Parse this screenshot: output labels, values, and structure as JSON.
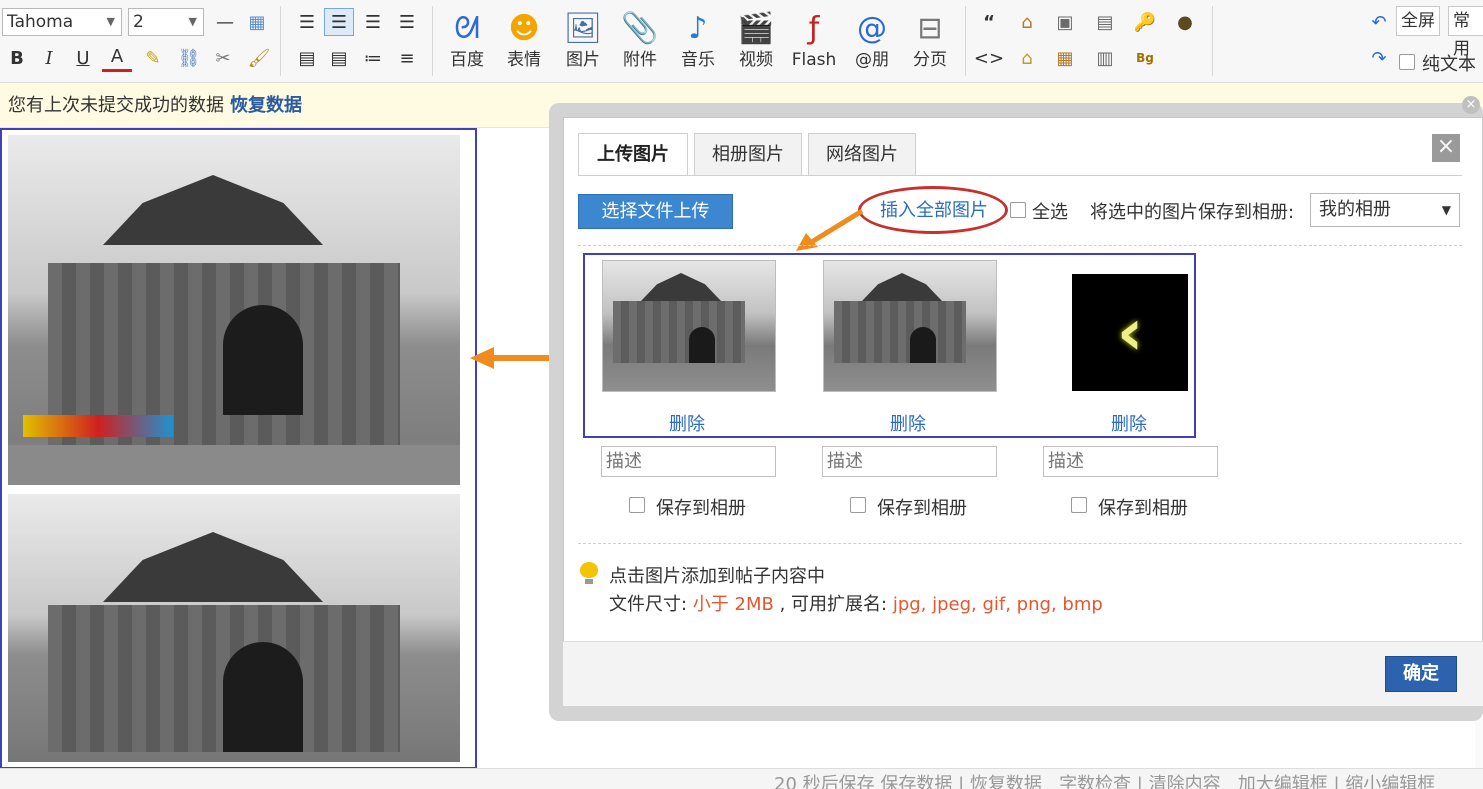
{
  "toolbar": {
    "font_family": "Tahoma",
    "font_size": "2",
    "buttons": {
      "baidu": "百度",
      "emoji": "表情",
      "image": "图片",
      "attach": "附件",
      "music": "音乐",
      "video": "视频",
      "flash": "Flash",
      "at": "@朋",
      "pagebreak": "分页"
    },
    "fullscreen": "全屏",
    "common": "常用",
    "plaintext": "纯文本"
  },
  "notice": {
    "text": "您有上次未提交成功的数据",
    "restore_link": "恢复数据"
  },
  "dialog": {
    "tabs": [
      "上传图片",
      "相册图片",
      "网络图片"
    ],
    "close": "×",
    "upload_button": "选择文件上传",
    "insert_all": "插入全部图片",
    "select_all": "全选",
    "save_to_album_label": "将选中的图片保存到相册:",
    "album_value": "我的相册",
    "delete_label": "删除",
    "desc_placeholder": "描述",
    "save_to_album": "保存到相册",
    "tip_line1": "点击图片添加到帖子内容中",
    "size_prefix": "文件尺寸: ",
    "size_value": "小于 2MB",
    "ext_prefix": " , 可用扩展名: ",
    "ext_value": "jpg, jpeg, gif, png, bmp",
    "confirm": "确定"
  },
  "statusbar": {
    "autosave": "20 秒后保存",
    "save": "保存数据",
    "restore": "恢复数据",
    "wordcheck": "字数检查",
    "clear": "清除内容",
    "enlarge": "加大编辑框",
    "shrink": "缩小编辑框"
  },
  "colors": {
    "accent_blue": "#3d86d0",
    "confirm_blue": "#2d63ae",
    "link_blue": "#2b6cc0",
    "highlight_red": "#c8302c",
    "arrow_orange": "#f08c1e",
    "info_red": "#e5572f"
  }
}
